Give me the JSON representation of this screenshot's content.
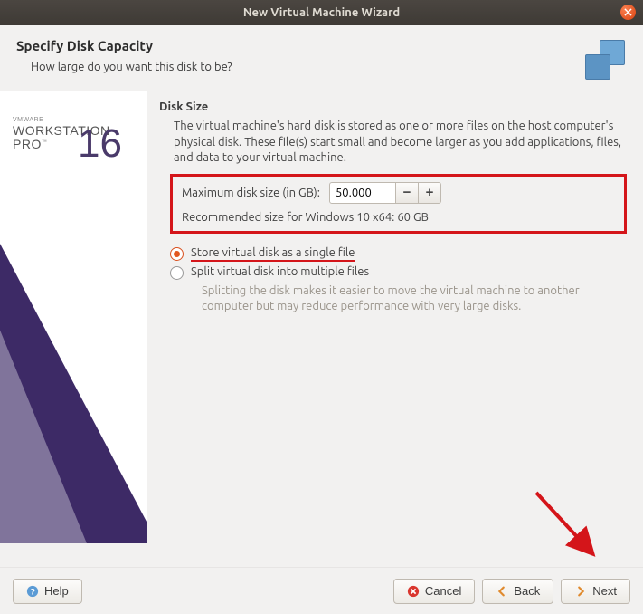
{
  "window": {
    "title": "New Virtual Machine Wizard"
  },
  "header": {
    "title": "Specify Disk Capacity",
    "subtitle": "How large do you want this disk to be?"
  },
  "brand": {
    "line1": "VMWARE",
    "line2": "WORKSTATION",
    "line3": "PRO",
    "version": "16"
  },
  "content": {
    "section_title": "Disk Size",
    "description": "The virtual machine's hard disk is stored as one or more files on the host computer's physical disk. These file(s) start small and become larger as you add applications, files, and data to your virtual machine.",
    "max_label": "Maximum disk size (in GB):",
    "max_value": "50.000",
    "minus": "−",
    "plus": "+",
    "recommended": "Recommended size for Windows 10 x64: 60 GB",
    "radio_single": "Store virtual disk as a single file",
    "radio_split": "Split virtual disk into multiple files",
    "split_help": "Splitting the disk makes it easier to move the virtual machine to another computer but may reduce performance with very large disks."
  },
  "footer": {
    "help": "Help",
    "cancel": "Cancel",
    "back": "Back",
    "next": "Next"
  }
}
